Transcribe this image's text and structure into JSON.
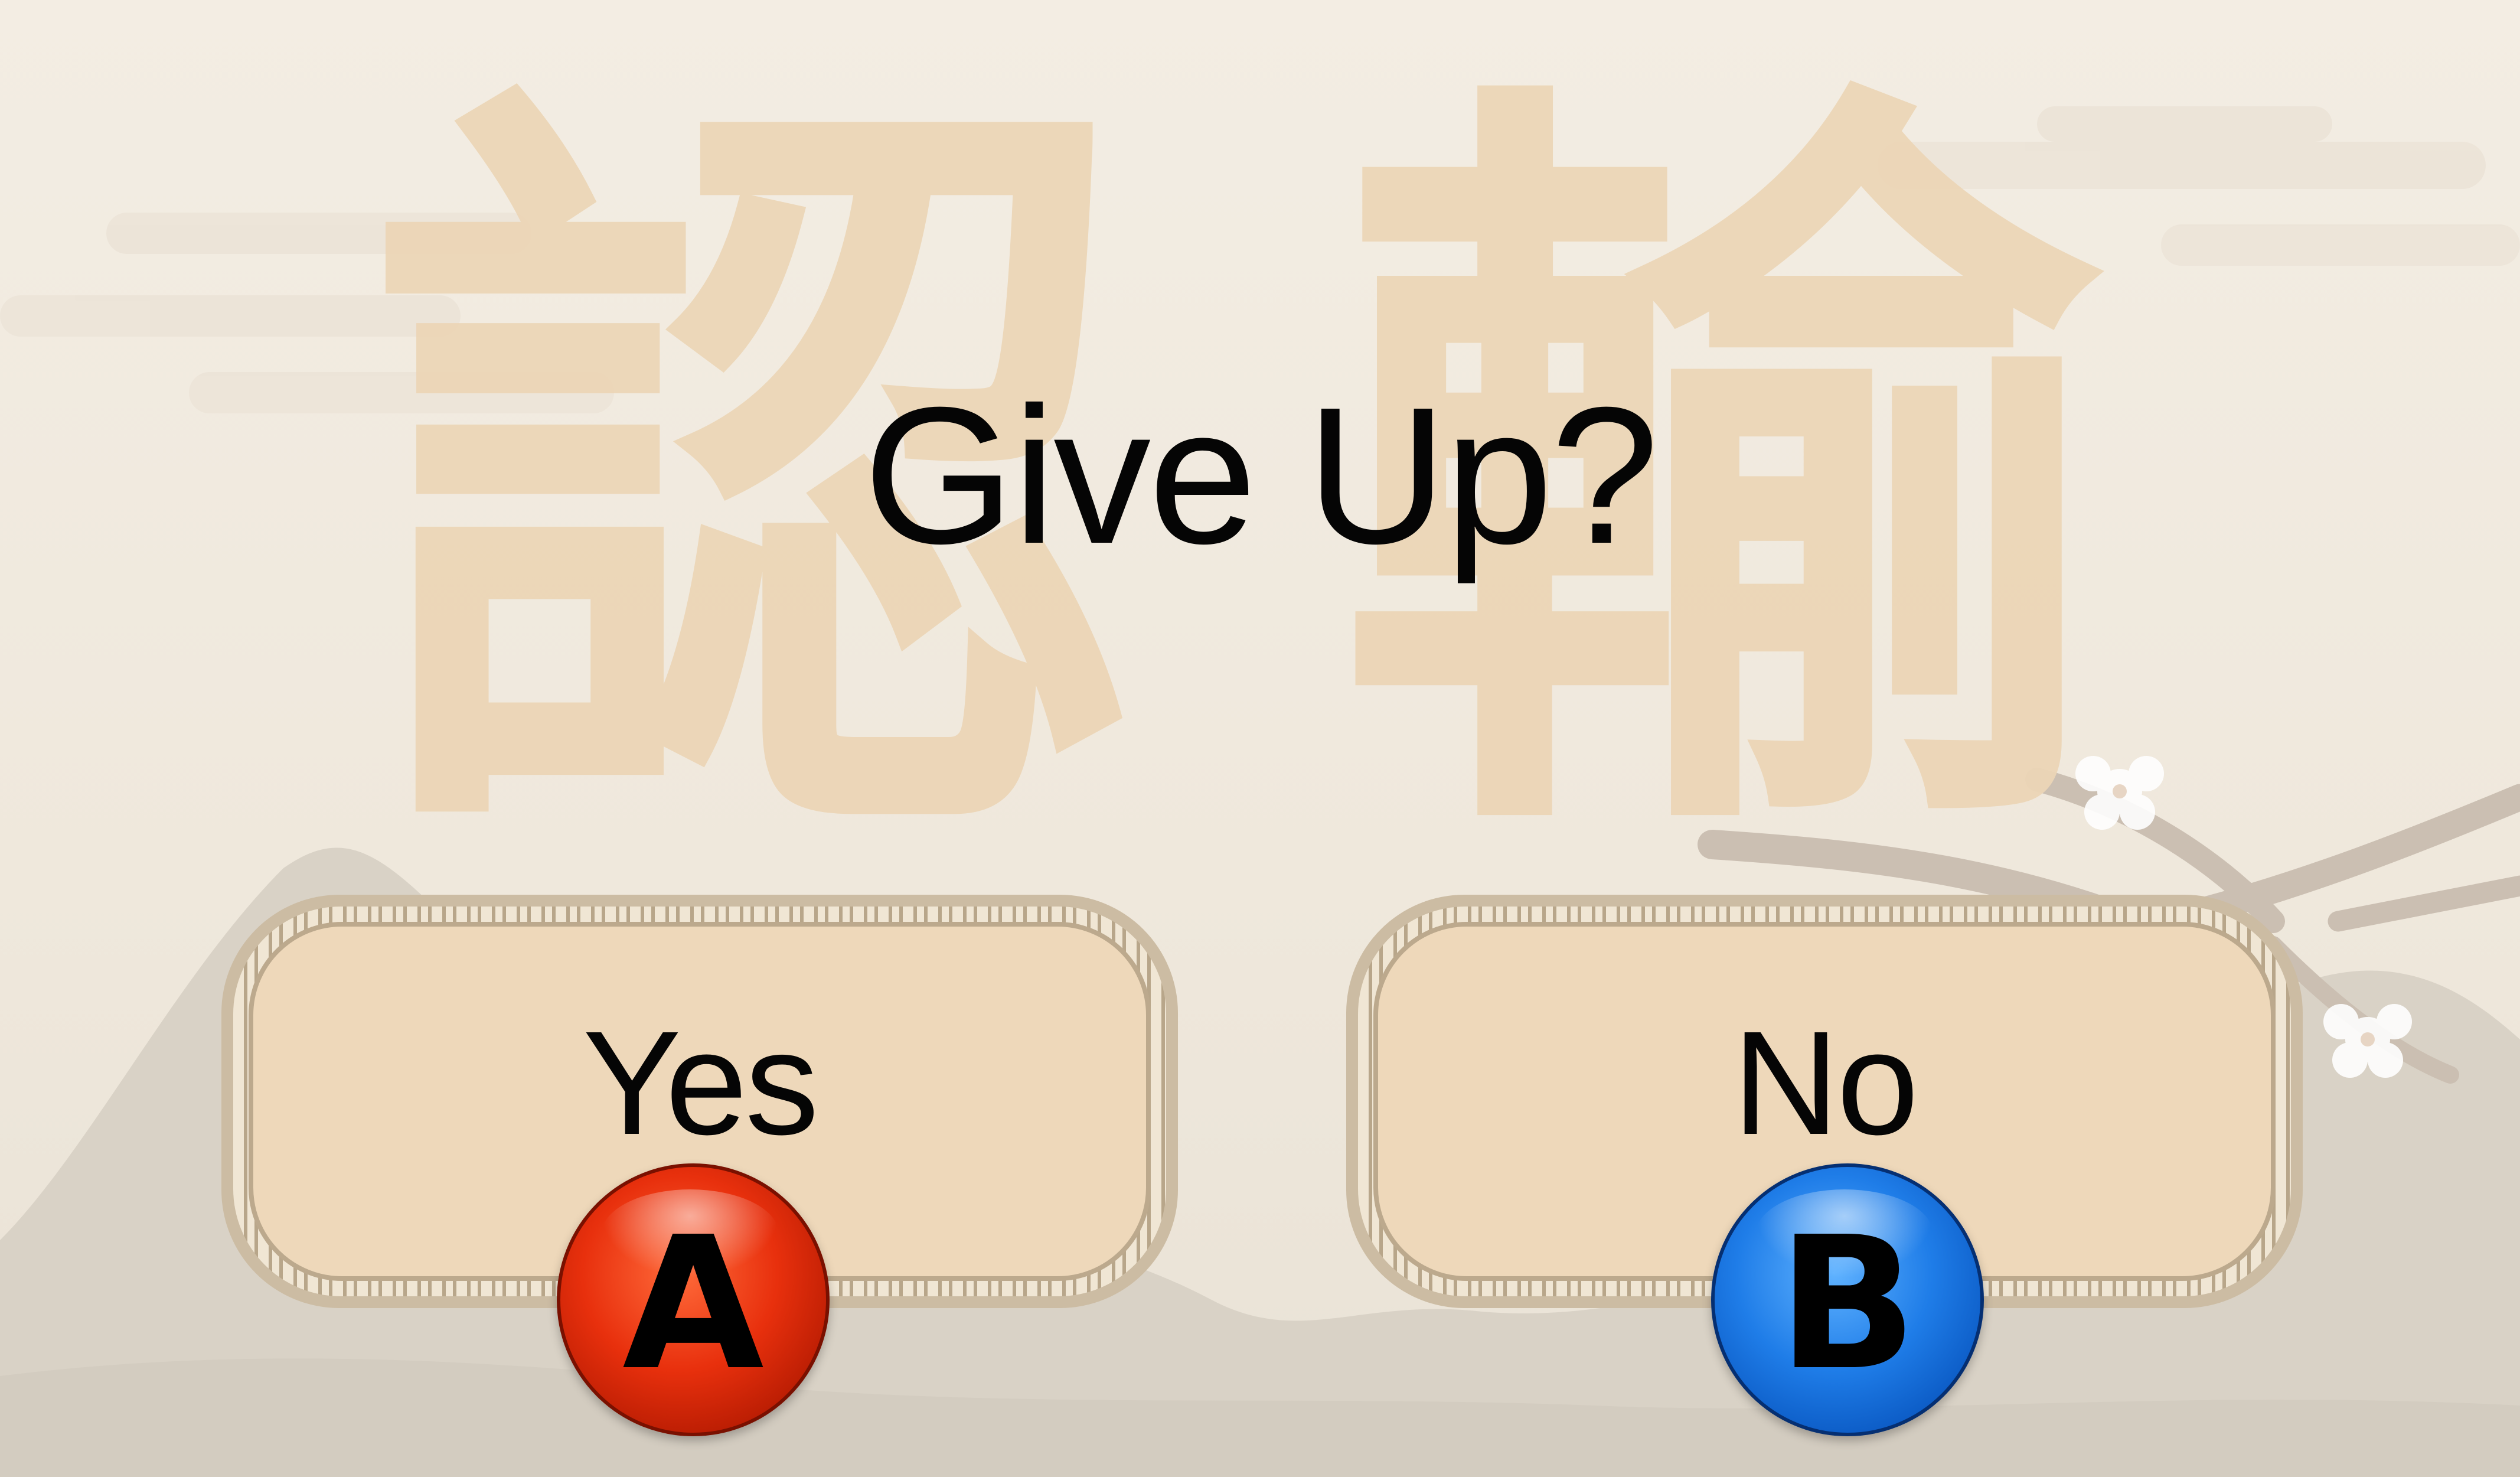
{
  "dialog": {
    "title": "Give Up?",
    "background_characters": [
      "認",
      "輸"
    ]
  },
  "options": [
    {
      "label": "Yes",
      "button": "A",
      "button_color": "#e2300e"
    },
    {
      "label": "No",
      "button": "B",
      "button_color": "#1f7de8"
    }
  ],
  "colors": {
    "background": "#f1ebe0",
    "calligraphy": "#ecd6b7",
    "panel_fill": "#eed8ba",
    "panel_border": "#ccbca3",
    "text": "#050505"
  }
}
